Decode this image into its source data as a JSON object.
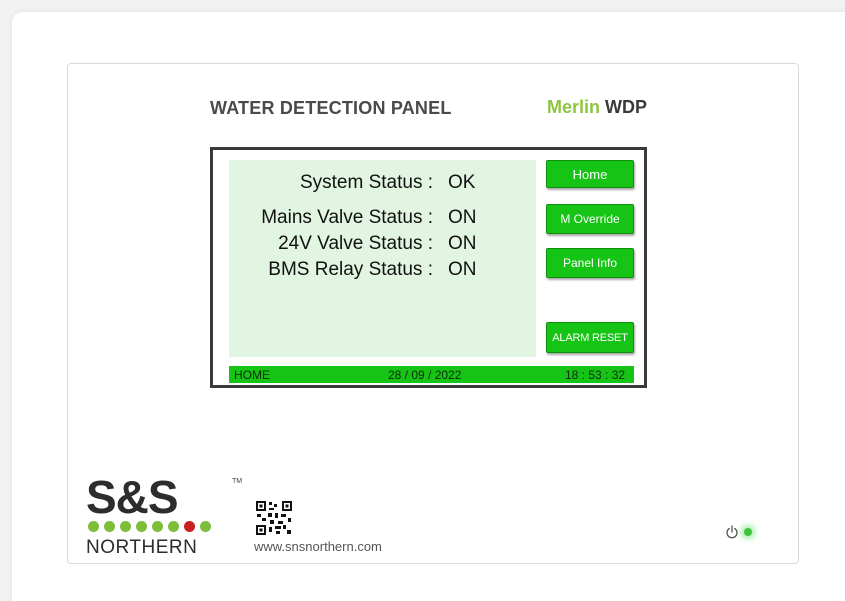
{
  "panel": {
    "title": "WATER DETECTION PANEL",
    "brand_merlin": "Merlin",
    "brand_wdp": "WDP"
  },
  "screen": {
    "status_rows": [
      {
        "label": "System Status :",
        "value": "OK"
      },
      {
        "label": "Mains Valve Status :",
        "value": "ON"
      },
      {
        "label": "24V Valve Status :",
        "value": "ON"
      },
      {
        "label": "BMS Relay Status :",
        "value": "ON"
      }
    ],
    "buttons": {
      "home": "Home",
      "override": "M Override",
      "panel_info": "Panel Info",
      "alarm_reset": "ALARM RESET"
    },
    "statusbar": {
      "page": "HOME",
      "date": "28 / 09 / 2022",
      "time": "18 : 53 : 32"
    }
  },
  "footer": {
    "logo_top": "S&S",
    "logo_tm": "TM",
    "logo_bottom": "NORTHERN",
    "website": "www.snsnorthern.com",
    "power_led": "on"
  },
  "colors": {
    "button_green": "#16c416",
    "screen_bg": "#e2f5e2",
    "brand_green": "#8cc63f",
    "dot_green": "#7cbd3a",
    "dot_red": "#c82020"
  },
  "icons": [
    "power-icon",
    "qr-code-icon"
  ]
}
